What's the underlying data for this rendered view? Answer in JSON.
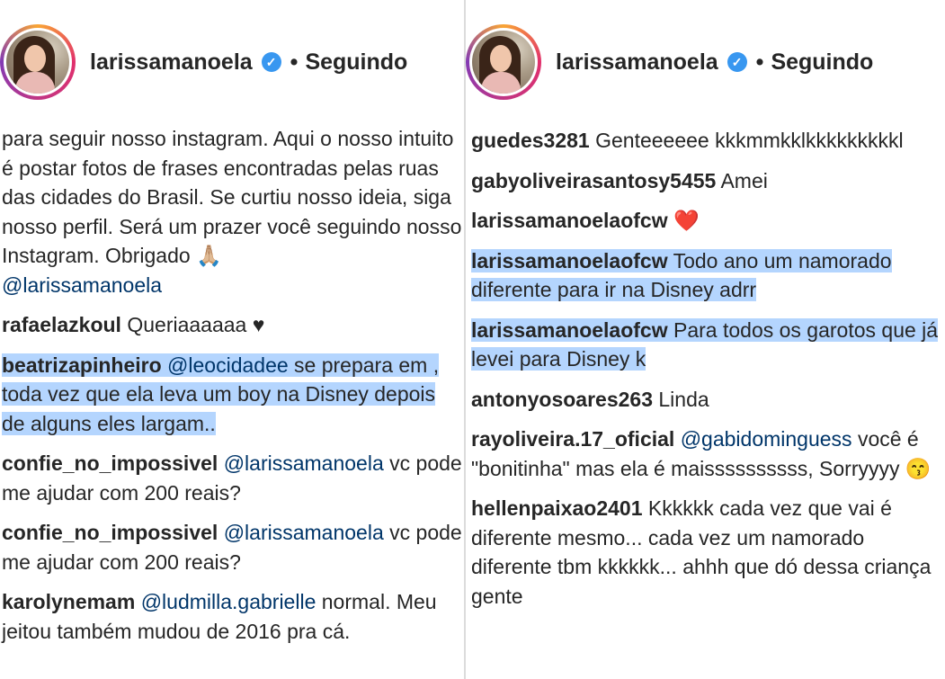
{
  "left": {
    "header": {
      "username": "larissamanoela",
      "separator": "•",
      "follow_status": "Seguindo"
    },
    "caption": {
      "text": "para seguir nosso instagram. Aqui o nosso intuito é postar fotos de frases encontradas pelas ruas das cidades do Brasil. Se curtiu nosso ideia, siga nosso perfil. Será um prazer você seguindo nosso Instagram. Obrigado 🙏🏼",
      "mention": "@larissamanoela"
    },
    "comments": [
      {
        "user": "rafaelazkoul",
        "text": "Queriaaaaaa ♥"
      },
      {
        "user": "beatrizapinheiro",
        "mention": "@leocidadee",
        "text": "se prepara em , toda vez que ela leva um boy na Disney depois de alguns eles largam.."
      },
      {
        "user": "confie_no_impossivel",
        "mention": "@larissamanoela",
        "text": "vc pode me ajudar com 200 reais?"
      },
      {
        "user": "confie_no_impossivel",
        "mention": "@larissamanoela",
        "text": "vc pode me ajudar com 200 reais?"
      },
      {
        "user": "karolynemam",
        "mention": "@ludmilla.gabrielle",
        "text": "normal. Meu jeitou também mudou de 2016 pra cá."
      }
    ]
  },
  "right": {
    "header": {
      "username": "larissamanoela",
      "separator": "•",
      "follow_status": "Seguindo"
    },
    "comments": [
      {
        "user": "guedes3281",
        "text": "Genteeeeee kkkmmkklkkkkkkkkkl"
      },
      {
        "user": "gabyoliveirasantosy5455",
        "text": "Amei"
      },
      {
        "user": "larissamanoelaofcw",
        "text": "❤️"
      },
      {
        "user": "larissamanoelaofcw",
        "text": "Todo ano um namorado diferente para ir na Disney adrr"
      },
      {
        "user": "larissamanoelaofcw",
        "text": "Para todos os garotos que já levei para Disney k"
      },
      {
        "user": "antonyosoares263",
        "text": "Linda"
      },
      {
        "user": "rayoliveira.17_oficial",
        "mention": "@gabidominguess",
        "text": "você é \"bonitinha\" mas ela é maissssssssss, Sorryyyy 😙"
      },
      {
        "user": "hellenpaixao2401",
        "text": "Kkkkkk cada vez que vai é diferente mesmo... cada vez um namorado diferente tbm kkkkkk... ahhh que dó dessa criança gente"
      }
    ]
  },
  "colors": {
    "highlight": "#b4d5fe",
    "verified": "#3897f0",
    "mention": "#003569"
  }
}
